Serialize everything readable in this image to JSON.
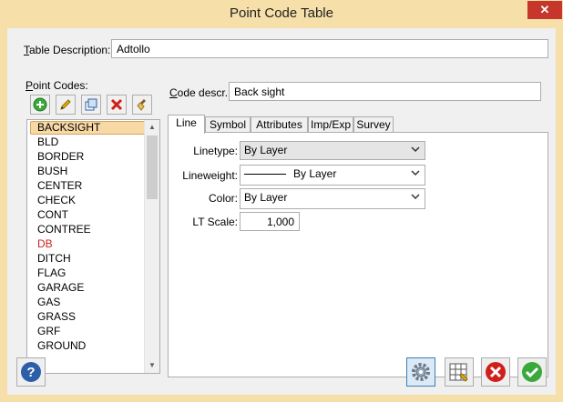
{
  "window": {
    "title": "Point Code Table",
    "close_glyph": "✕"
  },
  "table_description": {
    "label": "Table Description:",
    "value": "Adtollo"
  },
  "point_codes": {
    "label": "Point Codes:",
    "toolbar_icons": [
      "add-icon",
      "edit-icon",
      "copy-icon",
      "delete-icon",
      "clean-icon"
    ],
    "items": [
      "BACKSIGHT",
      "BLD",
      "BORDER",
      "BUSH",
      "CENTER",
      "CHECK",
      "CONT",
      "CONTREE",
      "DB",
      "DITCH",
      "FLAG",
      "GARAGE",
      "GAS",
      "GRASS",
      "GRF",
      "GROUND"
    ],
    "selected": "BACKSIGHT",
    "highlight_item": "DB",
    "highlight_color": "#d0201b"
  },
  "code_descr": {
    "label": "Code descr.:",
    "value": "Back sight"
  },
  "tabs": [
    "Line",
    "Symbol",
    "Attributes",
    "Imp/Exp",
    "Survey"
  ],
  "active_tab": "Line",
  "line_tab": {
    "linetype_label": "Linetype:",
    "linetype_value": "By Layer",
    "lineweight_label": "Lineweight:",
    "lineweight_value": "By Layer",
    "color_label": "Color:",
    "color_value": "By Layer",
    "ltscale_label": "LT Scale:",
    "ltscale_value": "1,000"
  },
  "bottom_icons": [
    "help-icon",
    "settings-icon",
    "table-icon",
    "cancel-icon",
    "ok-icon"
  ],
  "colors": {
    "title_bar": "#f6dfa8",
    "close_button": "#c7362b",
    "selection": "#f7d9a6"
  }
}
